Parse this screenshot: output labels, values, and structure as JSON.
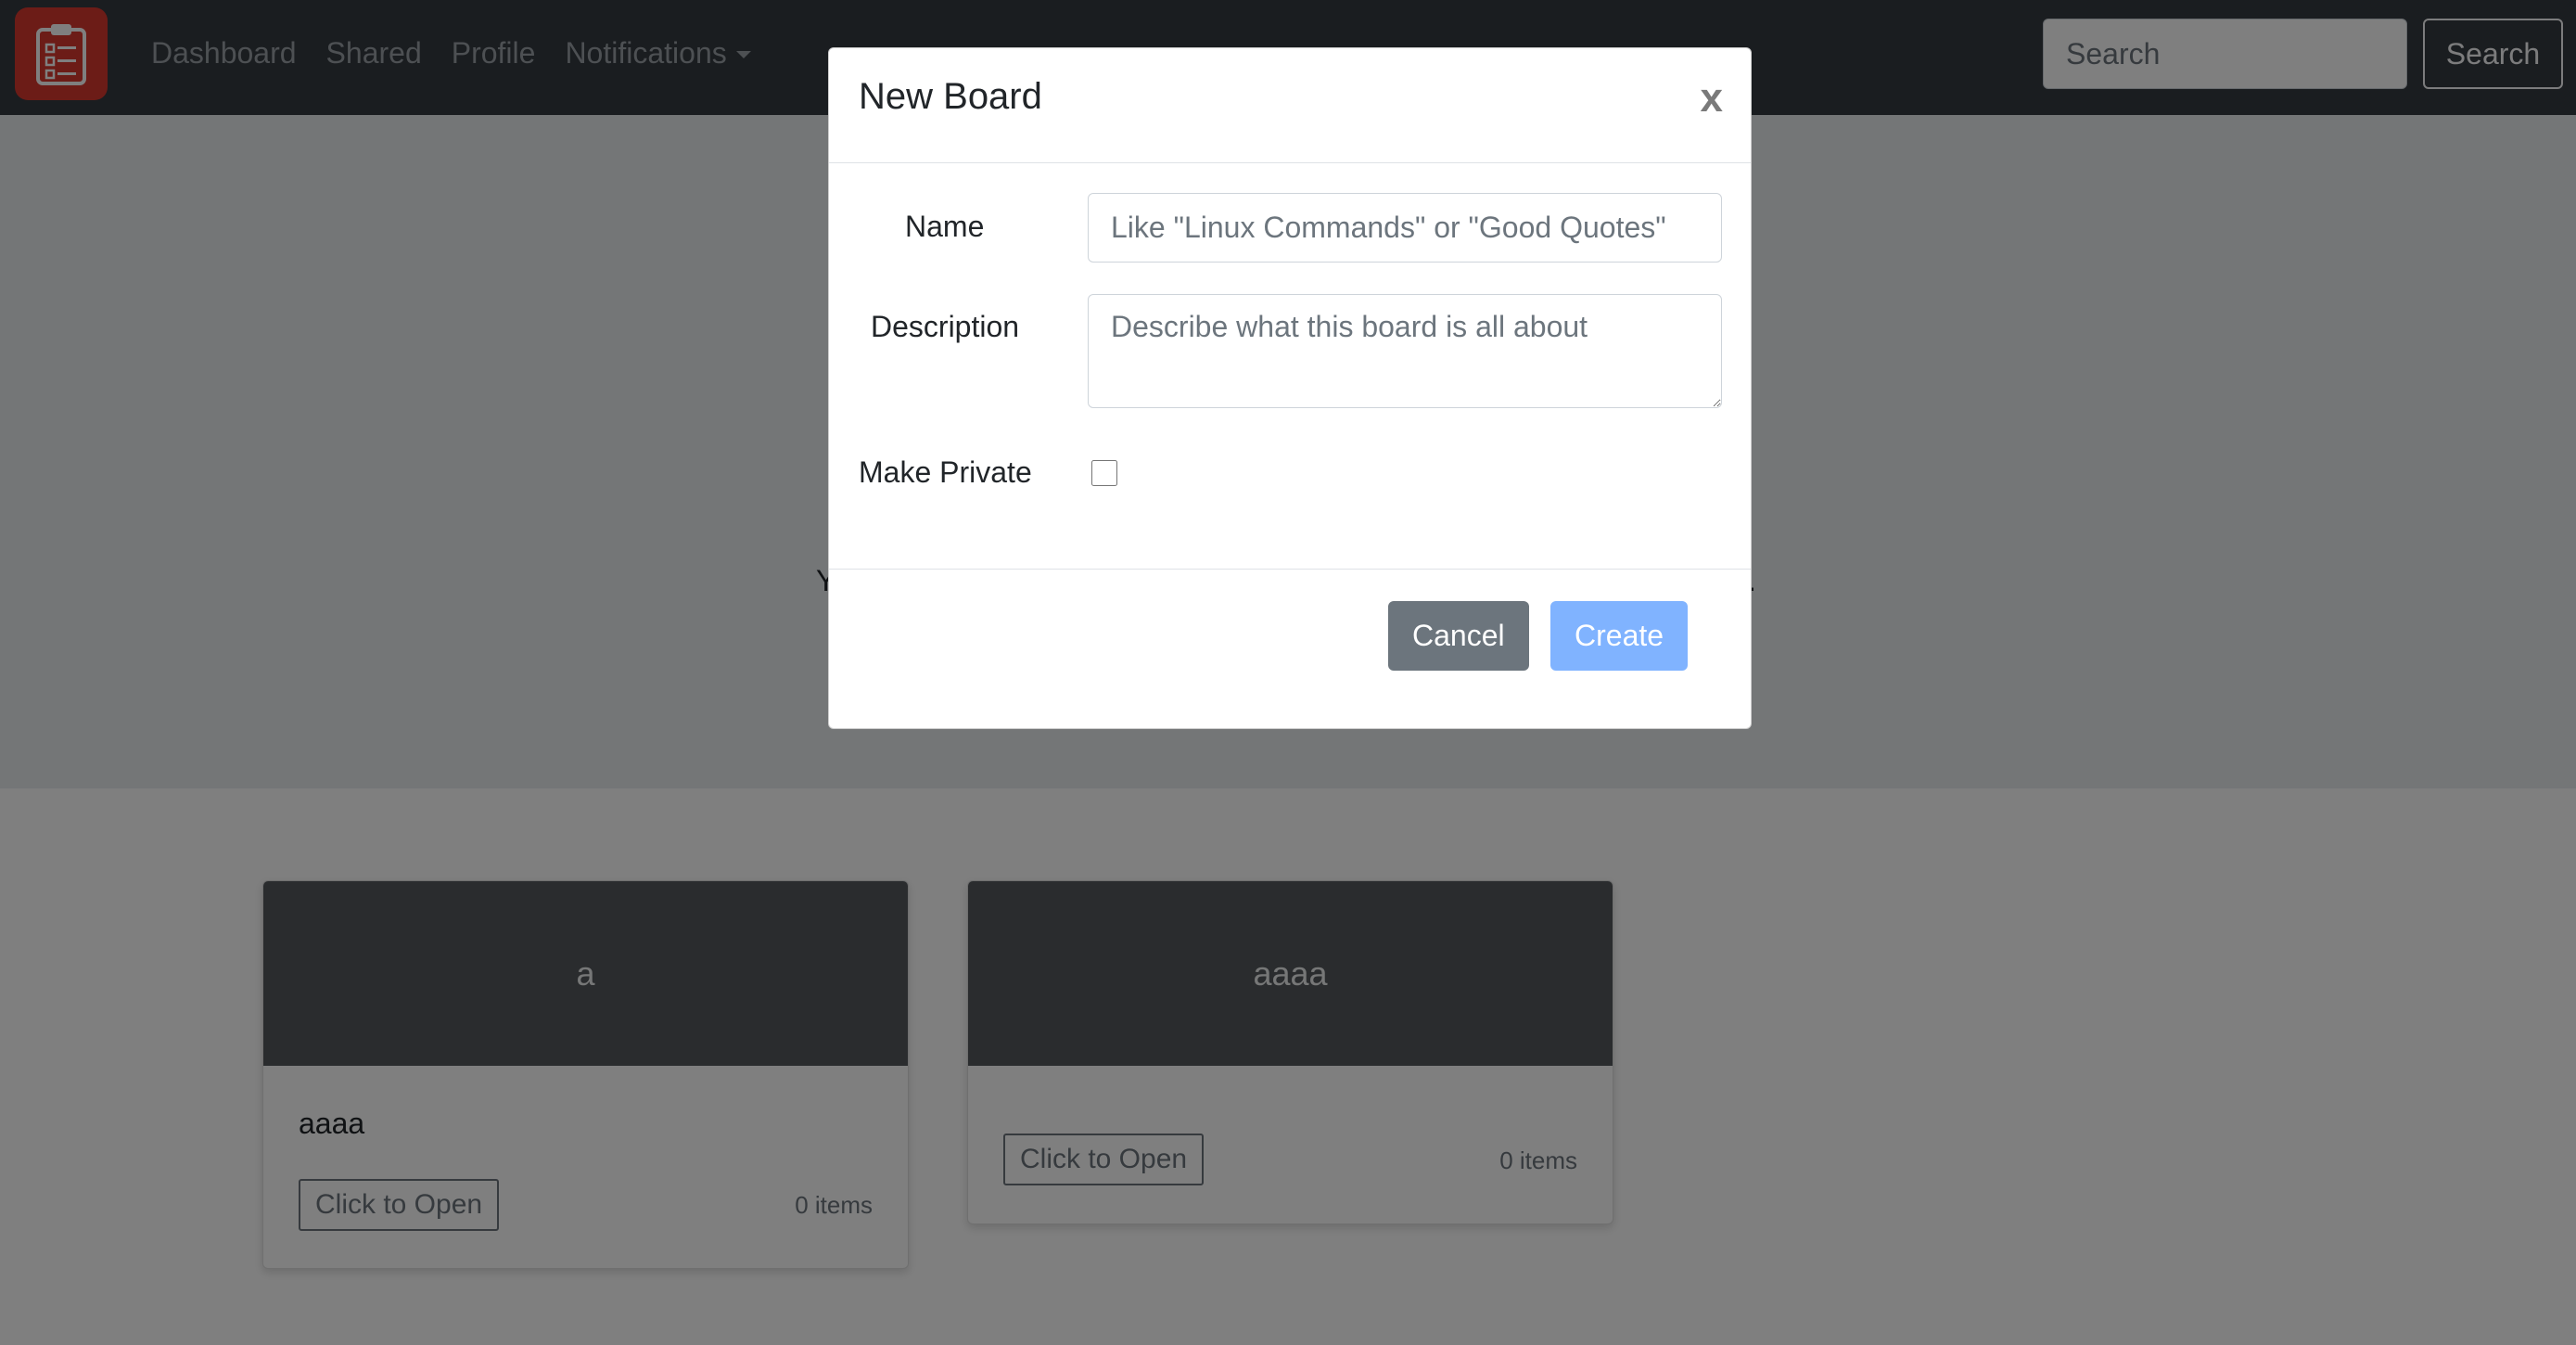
{
  "navbar": {
    "links": [
      {
        "label": "Dashboard"
      },
      {
        "label": "Shared"
      },
      {
        "label": "Profile"
      },
      {
        "label": "Notifications"
      }
    ],
    "search_placeholder": "Search",
    "search_button_label": "Search"
  },
  "jumbotron": {
    "partial_text_start": "Y",
    "partial_text_end": "."
  },
  "boards": [
    {
      "header": "a",
      "title": "aaaa",
      "open_label": "Click to Open",
      "count": "0 items"
    },
    {
      "header": "aaaa",
      "title": "",
      "open_label": "Click to Open",
      "count": "0 items"
    }
  ],
  "modal": {
    "title": "New Board",
    "close_label": "x",
    "name_label": "Name",
    "name_placeholder": "Like \"Linux Commands\" or \"Good Quotes\"",
    "description_label": "Description",
    "description_placeholder": "Describe what this board is all about",
    "private_label": "Make Private",
    "cancel_label": "Cancel",
    "create_label": "Create"
  },
  "colors": {
    "navbar": "#343a40",
    "brand": "#d9392f",
    "create_button": "#80b3ff",
    "cancel_button": "#6c757d"
  },
  "icons": {
    "brand": "clipboard-checklist-icon"
  }
}
